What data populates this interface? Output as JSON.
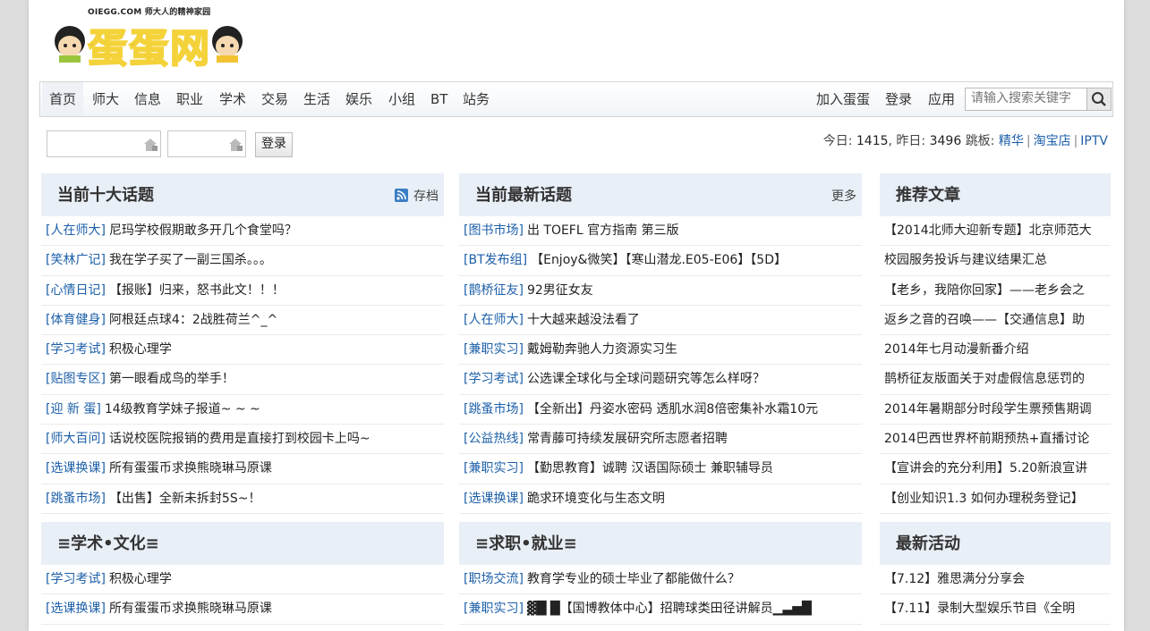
{
  "logo": {
    "site_url": "OIEGG.COM",
    "slogan": "师大人的精神家园",
    "name": "蛋蛋网"
  },
  "nav": {
    "items": [
      "首页",
      "师大",
      "信息",
      "职业",
      "学术",
      "交易",
      "生活",
      "娱乐",
      "小组",
      "BT",
      "站务"
    ],
    "right": [
      "加入蛋蛋",
      "登录",
      "应用"
    ],
    "search_placeholder": "请输入搜索关键字"
  },
  "login": {
    "button": "登录"
  },
  "stats": {
    "today_label": "今日:",
    "today": "1415",
    "yesterday_label": "昨日:",
    "yesterday": "3496",
    "jump_label": "跳板:",
    "links": [
      "精华",
      "淘宝店",
      "IPTV"
    ]
  },
  "panels": {
    "top10": {
      "title": "当前十大话题",
      "tool": "存档",
      "items": [
        {
          "cat": "[人在师大]",
          "title": "尼玛学校假期敢多开几个食堂吗？"
        },
        {
          "cat": "[笑林广记]",
          "title": "我在学子买了一副三国杀。。。"
        },
        {
          "cat": "[心情日记]",
          "title": "【报账】归来，怒书此文！！！"
        },
        {
          "cat": "[体育健身]",
          "title": "阿根廷点球4：2战胜荷兰^_^"
        },
        {
          "cat": "[学习考试]",
          "title": "积极心理学"
        },
        {
          "cat": "[贴图专区]",
          "title": "第一眼看成鸟的举手！"
        },
        {
          "cat": "[迎 新 蛋]",
          "title": "14级教育学妹子报道~ ~ ~"
        },
        {
          "cat": "[师大百问]",
          "title": "话说校医院报销的费用是直接打到校园卡上吗~"
        },
        {
          "cat": "[选课换课]",
          "title": "所有蛋蛋币求换熊晓琳马原课"
        },
        {
          "cat": "[跳蚤市场]",
          "title": "【出售】全新未拆封5S~！"
        }
      ]
    },
    "latest": {
      "title": "当前最新话题",
      "tool": "更多",
      "items": [
        {
          "cat": "[图书市场]",
          "title": "出 TOEFL 官方指南 第三版"
        },
        {
          "cat": "[BT发布组]",
          "title": "【Enjoy&微笑】【寒山潜龙.E05-E06】【5D】"
        },
        {
          "cat": "[鹊桥征友]",
          "title": "92男征女友"
        },
        {
          "cat": "[人在师大]",
          "title": "十大越来越没法看了"
        },
        {
          "cat": "[兼职实习]",
          "title": "戴姆勒奔驰人力资源实习生"
        },
        {
          "cat": "[学习考试]",
          "title": "公选课全球化与全球问题研究等怎么样呀？"
        },
        {
          "cat": "[跳蚤市场]",
          "title": "【全新出】丹姿水密码 透肌水润8倍密集补水霜10元"
        },
        {
          "cat": "[公益热线]",
          "title": "常青藤可持续发展研究所志愿者招聘"
        },
        {
          "cat": "[兼职实习]",
          "title": "【勤思教育】诚聘 汉语国际硕士 兼职辅导员"
        },
        {
          "cat": "[选课换课]",
          "title": "跪求环境变化与生态文明"
        }
      ]
    },
    "recommend": {
      "title": "推荐文章",
      "items": [
        "【2014北师大迎新专题】北京师范大",
        "校园服务投诉与建议结果汇总",
        "【老乡，我陪你回家】——老乡会之",
        "返乡之音的召唤——【交通信息】助",
        "2014年七月动漫新番介绍",
        "鹊桥征友版面关于对虚假信息惩罚的",
        "2014年暑期部分时段学生票预售期调",
        "2014巴西世界杯前期预热+直播讨论",
        "【宣讲会的充分利用】5.20新浪宣讲",
        "【创业知识1.3 如何办理税务登记】"
      ]
    },
    "academic": {
      "title": "≡学术•文化≡",
      "items": [
        {
          "cat": "[学习考试]",
          "title": "积极心理学"
        },
        {
          "cat": "[选课换课]",
          "title": "所有蛋蛋币求换熊晓琳马原课"
        }
      ]
    },
    "jobs": {
      "title": "≡求职•就业≡",
      "items": [
        {
          "cat": "[职场交流]",
          "title": "教育学专业的硕士毕业了都能做什么？"
        },
        {
          "cat": "[兼职实习]",
          "title": "▓█ █【国博教体中心】招聘球类田径讲解员▁▃▅█"
        }
      ]
    },
    "activities": {
      "title": "最新活动",
      "items": [
        "【7.12】雅思满分分享会",
        "【7.11】录制大型娱乐节目《全明"
      ]
    }
  },
  "colors": {
    "link_blue": "#1c5fa8",
    "panel_head": "#e9eff7",
    "page_bg": "#dcdcdc"
  }
}
